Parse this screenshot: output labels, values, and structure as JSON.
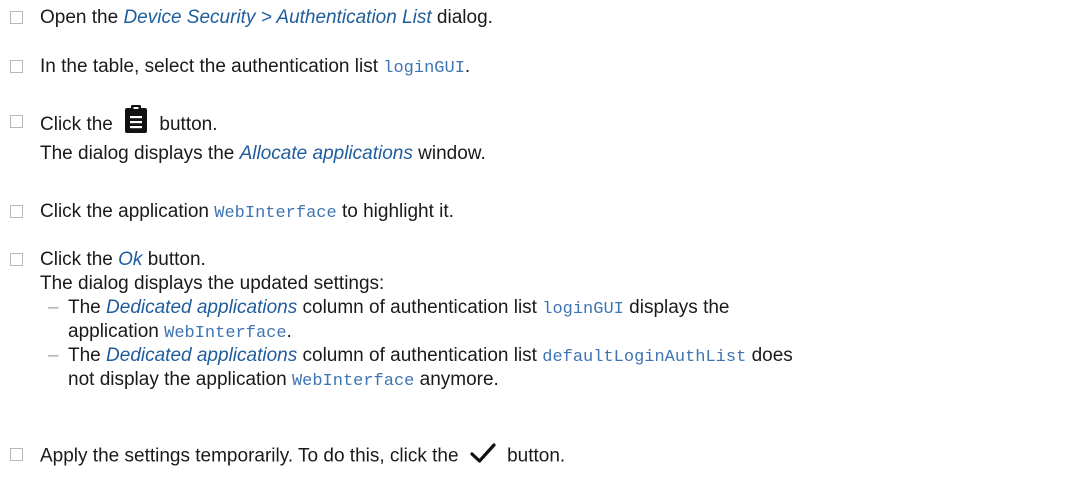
{
  "steps": [
    {
      "a": "Open the ",
      "link": "Device Security > Authentication List",
      "b": " dialog."
    },
    {
      "a": "In the table, select the authentication list ",
      "code": "loginGUI",
      "b": "."
    },
    {
      "a": "Click the ",
      "icon": "clipboard-icon",
      "b": " button.",
      "result": {
        "a": "The dialog displays the ",
        "link": "Allocate applications",
        "b": " window."
      }
    },
    {
      "a": "Click the application ",
      "code": "WebInterface",
      "b": " to highlight it."
    },
    {
      "a": "Click the ",
      "link": "Ok",
      "b": " button.",
      "result": "The dialog displays the updated settings:",
      "bullets": [
        {
          "a": "The ",
          "link": "Dedicated applications",
          "b": " column of authentication list ",
          "code": "loginGUI",
          "c": " displays the",
          "a2": "application ",
          "code2": "WebInterface",
          "b2": "."
        },
        {
          "a": "The ",
          "link": "Dedicated applications",
          "b": " column of authentication list ",
          "code": "defaultLoginAuthList",
          "c": " does",
          "a2": "not display the application ",
          "code2": "WebInterface",
          "b2": " anymore."
        }
      ]
    },
    {
      "a": "Apply the settings temporarily. To do this, click the ",
      "icon": "checkmark-icon",
      "b": " button."
    }
  ],
  "colors": {
    "link": "#1f5d9c",
    "code": "#3f74b3",
    "checkbox": "#b8b8b8"
  }
}
